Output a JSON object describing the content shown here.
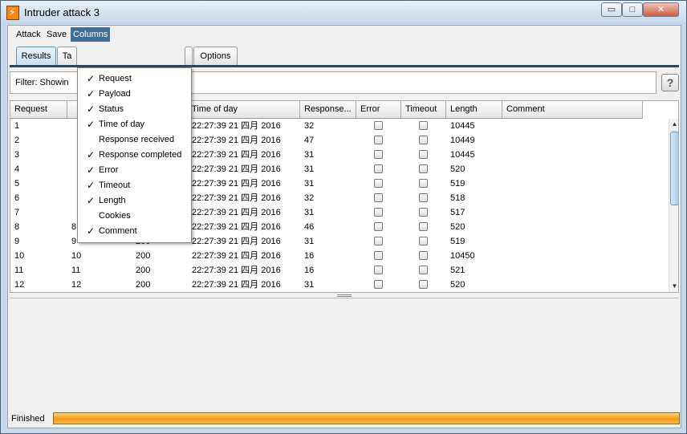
{
  "window": {
    "title": "Intruder attack 3",
    "minimize_icon": "minimize-icon",
    "maximize_icon": "maximize-icon",
    "close_icon": "close-icon",
    "minimize_glyph": "▭",
    "maximize_glyph": "□",
    "close_glyph": "✕"
  },
  "menubar": [
    {
      "label": "Attack",
      "active": false
    },
    {
      "label": "Save",
      "active": false
    },
    {
      "label": "Columns",
      "active": true
    }
  ],
  "tabs": [
    {
      "label": "Results",
      "active": true
    },
    {
      "label": "Ta",
      "active": false
    },
    {
      "label": "",
      "active": false
    },
    {
      "label": "Options",
      "active": false
    }
  ],
  "filter": {
    "text": "Filter: Showin",
    "help_label": "?"
  },
  "table": {
    "columns": [
      "Request",
      "",
      "",
      "Time of day",
      "Response...",
      "Error",
      "Timeout",
      "Length",
      "Comment"
    ],
    "rows": [
      {
        "request": "1",
        "payload": "",
        "status": "",
        "time": "22:27:39 21 四月 2016",
        "response": "32",
        "length": "10445"
      },
      {
        "request": "2",
        "payload": "",
        "status": "",
        "time": "22:27:39 21 四月 2016",
        "response": "47",
        "length": "10449"
      },
      {
        "request": "3",
        "payload": "",
        "status": "",
        "time": "22:27:39 21 四月 2016",
        "response": "31",
        "length": "10445"
      },
      {
        "request": "4",
        "payload": "",
        "status": "",
        "time": "22:27:39 21 四月 2016",
        "response": "31",
        "length": "520"
      },
      {
        "request": "5",
        "payload": "",
        "status": "",
        "time": "22:27:39 21 四月 2016",
        "response": "31",
        "length": "519"
      },
      {
        "request": "6",
        "payload": "",
        "status": "",
        "time": "22:27:39 21 四月 2016",
        "response": "32",
        "length": "518"
      },
      {
        "request": "7",
        "payload": "",
        "status": "",
        "time": "22:27:39 21 四月 2016",
        "response": "31",
        "length": "517"
      },
      {
        "request": "8",
        "payload": "8",
        "status": "200",
        "time": "22:27:39 21 四月 2016",
        "response": "46",
        "length": "520"
      },
      {
        "request": "9",
        "payload": "9",
        "status": "200",
        "time": "22:27:39 21 四月 2016",
        "response": "31",
        "length": "519"
      },
      {
        "request": "10",
        "payload": "10",
        "status": "200",
        "time": "22:27:39 21 四月 2016",
        "response": "16",
        "length": "10450"
      },
      {
        "request": "11",
        "payload": "11",
        "status": "200",
        "time": "22:27:39 21 四月 2016",
        "response": "16",
        "length": "521"
      },
      {
        "request": "12",
        "payload": "12",
        "status": "200",
        "time": "22:27:39 21 四月 2016",
        "response": "31",
        "length": "520"
      }
    ],
    "scroll_up": "▲",
    "scroll_down": "▼"
  },
  "columns_menu": [
    {
      "label": "Request",
      "checked": true
    },
    {
      "label": "Payload",
      "checked": true
    },
    {
      "label": "Status",
      "checked": true
    },
    {
      "label": "Time of day",
      "checked": true
    },
    {
      "label": "Response received",
      "checked": false
    },
    {
      "label": "Response completed",
      "checked": true
    },
    {
      "label": "Error",
      "checked": true
    },
    {
      "label": "Timeout",
      "checked": true
    },
    {
      "label": "Length",
      "checked": true
    },
    {
      "label": "Cookies",
      "checked": false
    },
    {
      "label": "Comment",
      "checked": true
    }
  ],
  "check_glyph": "✓",
  "status": {
    "text": "Finished",
    "progress": 1.0
  },
  "colors": {
    "progress": "#f29a18",
    "menu_active": "#3f6f97"
  }
}
